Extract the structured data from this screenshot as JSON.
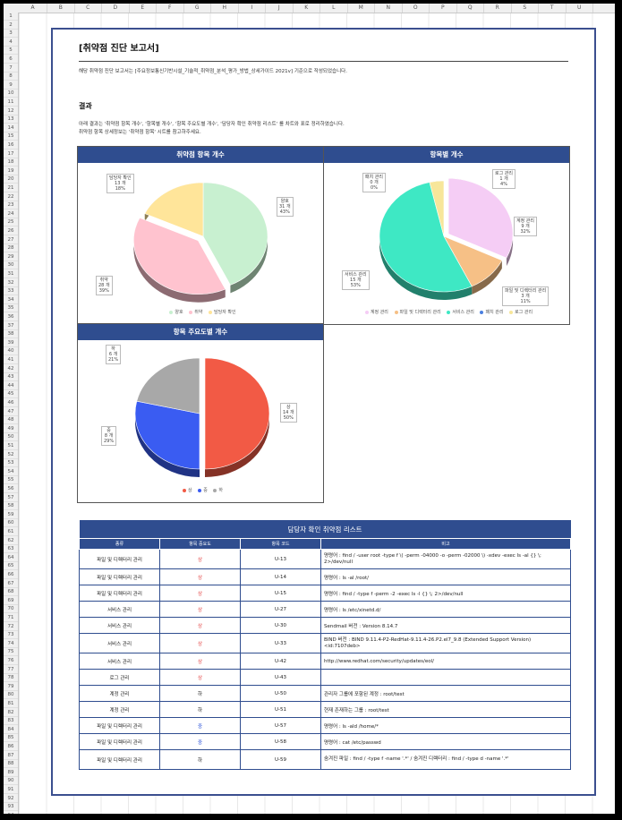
{
  "columns": [
    "A",
    "B",
    "C",
    "D",
    "E",
    "F",
    "G",
    "H",
    "I",
    "J",
    "K",
    "L",
    "M",
    "N",
    "O",
    "P",
    "Q",
    "R",
    "S",
    "T",
    "U"
  ],
  "report": {
    "title": "[취약점 진단 보고서]",
    "intro": "해당 취약점 진단 보고서는 [주요정보통신기반시설_기술적_취약점_분석_평가_방법_상세가이드 2021v] 기준으로 작성되었습니다.",
    "section": "결과",
    "desc1": "아래 결과는 '취약점 항목 개수', '항목별 개수', '항목 주요도별 개수', '담당자 확인 취약점 리스트' 를 차트와 표로 정리하였습니다.",
    "desc2": "취약점 항목 상세정보는 '취약점 항목' 시트를 참고하주세요."
  },
  "colors": {
    "header": "#2f4d8f",
    "good": "#c8f0d0",
    "weak": "#ffc3cf",
    "check": "#ffe59a",
    "acct": "#f5cdf5",
    "file": "#f6c086",
    "svc": "#3ee8c4",
    "patch": "#4a7fe0",
    "log": "#f7e69a",
    "high": "#f25a45",
    "mid": "#3a5cf2",
    "low": "#a8a8a8",
    "sev_high": "#e23b3b",
    "sev_mid": "#2a52d8",
    "sev_low": "#222222"
  },
  "charts": {
    "chart1": {
      "title": "취약점 항목 개수",
      "slices": [
        {
          "name": "양호",
          "count": "31 개",
          "pct": "43%"
        },
        {
          "name": "취약",
          "count": "28 개",
          "pct": "39%"
        },
        {
          "name": "담당자 확인",
          "count": "13 개",
          "pct": "18%"
        }
      ]
    },
    "chart2": {
      "title": "항목별 개수",
      "slices": [
        {
          "name": "계정 관리",
          "count": "9 개",
          "pct": "32%"
        },
        {
          "name": "파일 및 디렉터리 관리",
          "count": "3 개",
          "pct": "11%"
        },
        {
          "name": "서비스 관리",
          "count": "15 개",
          "pct": "53%"
        },
        {
          "name": "패치 관리",
          "count": "0 개",
          "pct": "0%"
        },
        {
          "name": "로그 관리",
          "count": "1 개",
          "pct": "4%"
        }
      ]
    },
    "chart3": {
      "title": "항목 주요도별 개수",
      "slices": [
        {
          "name": "상",
          "count": "14 개",
          "pct": "50%"
        },
        {
          "name": "중",
          "count": "8 개",
          "pct": "29%"
        },
        {
          "name": "하",
          "count": "6 개",
          "pct": "21%"
        }
      ]
    }
  },
  "chart_data": [
    {
      "type": "pie",
      "title": "취약점 항목 개수",
      "categories": [
        "양호",
        "취약",
        "담당자 확인"
      ],
      "values": [
        31,
        28,
        13
      ]
    },
    {
      "type": "pie",
      "title": "항목별 개수",
      "categories": [
        "계정 관리",
        "파일 및 디렉터리 관리",
        "서비스 관리",
        "패치 관리",
        "로그 관리"
      ],
      "values": [
        9,
        3,
        15,
        0,
        1
      ]
    },
    {
      "type": "pie",
      "title": "항목 주요도별 개수",
      "categories": [
        "상",
        "중",
        "하"
      ],
      "values": [
        14,
        8,
        6
      ]
    }
  ],
  "table": {
    "title": "담당자 확인 취약점 리스트",
    "headers": [
      "종류",
      "항목 중요도",
      "항목 코드",
      "비고"
    ],
    "rows": [
      {
        "cat": "파일 및 디렉터리 관리",
        "sev": "상",
        "code": "U-13",
        "note": "명령어 : find / -user root -type f \\( -perm -04000 -o -perm -02000 \\) -xdev -exec ls -al {} \\; 2>/dev/null"
      },
      {
        "cat": "파일 및 디렉터리 관리",
        "sev": "상",
        "code": "U-14",
        "note": "명령어 : ls -al /root/"
      },
      {
        "cat": "파일 및 디렉터리 관리",
        "sev": "상",
        "code": "U-15",
        "note": "명령어 : find / -type f -perm -2 -exec ls -l {} \\; 2>/dev/null"
      },
      {
        "cat": "서비스 관리",
        "sev": "상",
        "code": "U-27",
        "note": "명령어 : ls /etc/xinetd.d/"
      },
      {
        "cat": "서비스 관리",
        "sev": "상",
        "code": "U-30",
        "note": "Sendmail 버전 : Version 8.14.7"
      },
      {
        "cat": "서비스 관리",
        "sev": "상",
        "code": "U-33",
        "note": "BIND 버전 : BIND 9.11.4-P2-RedHat-9.11.4-26.P2.el7_9.8 (Extended Support Version) <id:7107deb>"
      },
      {
        "cat": "서비스 관리",
        "sev": "상",
        "code": "U-42",
        "note": "http://www.redhat.com/security/updates/eol/"
      },
      {
        "cat": "로그 관리",
        "sev": "상",
        "code": "U-43",
        "note": ""
      },
      {
        "cat": "계정 관리",
        "sev": "하",
        "code": "U-50",
        "note": "관리자 그룹에 포함된 계정 : root/test"
      },
      {
        "cat": "계정 관리",
        "sev": "하",
        "code": "U-51",
        "note": "현재 존재하는 그룹 : root/test"
      },
      {
        "cat": "파일 및 디렉터리 관리",
        "sev": "중",
        "code": "U-57",
        "note": "명령어 : ls -ald /home/*"
      },
      {
        "cat": "파일 및 디렉터리 관리",
        "sev": "중",
        "code": "U-58",
        "note": "명령어 : cat /etc/passwd"
      },
      {
        "cat": "파일 및 디렉터리 관리",
        "sev": "하",
        "code": "U-59",
        "note": "숨겨진 파일 : find / -type f -name '.*' / 숨겨진 디렉터리 : find / -type d -name '.*'"
      }
    ]
  }
}
